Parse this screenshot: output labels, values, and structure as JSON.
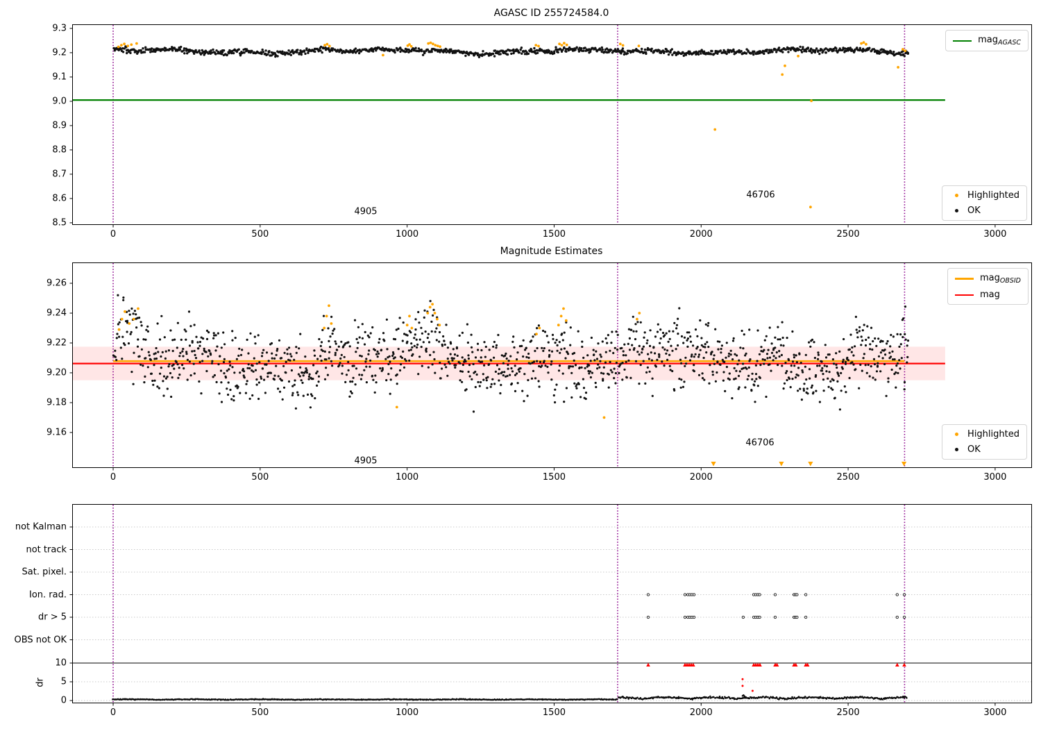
{
  "figure": {
    "background": "#ffffff"
  },
  "colors": {
    "ok": "#111111",
    "highlighted": "#ffa500",
    "mag_agasc_line": "#008000",
    "mag_line": "#ff0000",
    "mag_obsid_line": "#ffa500",
    "band": "rgba(255,60,60,0.13)",
    "vline": "#8a008a",
    "grid": "#c9c9c9",
    "flag_red": "#ff0000"
  },
  "chart_data": [
    {
      "type": "scatter",
      "title": "AGASC ID 255724584.0",
      "xlim": [
        -137,
        3123
      ],
      "ylim": [
        8.494,
        9.314
      ],
      "x_ticks": [
        0,
        500,
        1000,
        1500,
        2000,
        2500,
        3000
      ],
      "x_tick_labels": [
        "0",
        "500",
        "1000",
        "1500",
        "2000",
        "2500",
        "3000"
      ],
      "y_ticks": [
        9.3,
        9.2,
        9.1,
        9.0,
        8.9,
        8.8,
        8.7,
        8.6,
        8.5
      ],
      "y_tick_labels": [
        "9.3",
        "9.2",
        "9.1",
        "9.0",
        "8.9",
        "8.8",
        "8.7",
        "8.6",
        "8.5"
      ],
      "vlines": [
        0,
        1716,
        2692
      ],
      "hline": {
        "label_main": "mag",
        "label_sub": "AGASC",
        "y": 9.005,
        "x0": -137,
        "x1": 2830,
        "color": "#008000"
      },
      "ok_points": {
        "seed": 42,
        "n": 1050,
        "x_min": 2,
        "x_max": 2705,
        "base": 9.205,
        "noise_sd": 0.0055,
        "wander": [
          [
            0.006,
            120,
            0.5
          ],
          [
            0.004,
            37,
            2.1
          ]
        ],
        "bumps": {
          "centers": [
            30,
            730,
            1010,
            1090,
            1450,
            1530,
            2550
          ],
          "amp": 0.009,
          "width": 22
        },
        "clamp": [
          9.178,
          9.236
        ]
      },
      "highlighted_points": [
        [
          18,
          9.224
        ],
        [
          28,
          9.231
        ],
        [
          38,
          9.236
        ],
        [
          50,
          9.228
        ],
        [
          62,
          9.233
        ],
        [
          80,
          9.238
        ],
        [
          720,
          9.231
        ],
        [
          728,
          9.235
        ],
        [
          736,
          9.227
        ],
        [
          918,
          9.19
        ],
        [
          1002,
          9.229
        ],
        [
          1008,
          9.234
        ],
        [
          1014,
          9.226
        ],
        [
          1072,
          9.238
        ],
        [
          1080,
          9.241
        ],
        [
          1088,
          9.236
        ],
        [
          1096,
          9.231
        ],
        [
          1104,
          9.228
        ],
        [
          1112,
          9.225
        ],
        [
          1438,
          9.231
        ],
        [
          1447,
          9.227
        ],
        [
          1518,
          9.236
        ],
        [
          1526,
          9.231
        ],
        [
          1534,
          9.239
        ],
        [
          1543,
          9.232
        ],
        [
          1725,
          9.236
        ],
        [
          1734,
          9.23
        ],
        [
          1788,
          9.228
        ],
        [
          2047,
          8.884
        ],
        [
          2276,
          9.11
        ],
        [
          2285,
          9.146
        ],
        [
          2330,
          9.186
        ],
        [
          2372,
          8.565
        ],
        [
          2375,
          9.002
        ],
        [
          2545,
          9.238
        ],
        [
          2553,
          9.242
        ],
        [
          2561,
          9.235
        ],
        [
          2670,
          9.14
        ],
        [
          2686,
          9.214
        ],
        [
          2694,
          9.208
        ]
      ],
      "scatter_legend": {
        "highlighted": "Highlighted",
        "ok": "OK"
      },
      "annotations": [
        {
          "text": "4905",
          "x": 859
        },
        {
          "text": "46706",
          "x": 2202
        }
      ]
    },
    {
      "type": "scatter",
      "title": "Magnitude Estimates",
      "xlim": [
        -137,
        3123
      ],
      "ylim": [
        9.1367,
        9.2735
      ],
      "x_ticks": [
        0,
        500,
        1000,
        1500,
        2000,
        2500,
        3000
      ],
      "x_tick_labels": [
        "0",
        "500",
        "1000",
        "1500",
        "2000",
        "2500",
        "3000"
      ],
      "y_ticks": [
        9.26,
        9.24,
        9.22,
        9.2,
        9.18,
        9.16
      ],
      "y_tick_labels": [
        "9.26",
        "9.24",
        "9.22",
        "9.20",
        "9.18",
        "9.16"
      ],
      "vlines": [
        0,
        1716,
        2692
      ],
      "band": {
        "y0": 9.195,
        "y1": 9.2175,
        "x0": -137,
        "x1": 2830
      },
      "hlines": [
        {
          "label_main": "mag",
          "label_sub": "OBSID",
          "y": 9.2078,
          "x0": 0,
          "x1": 2692,
          "color": "#ffa500",
          "width": 2.6
        },
        {
          "label_main": "mag",
          "y": 9.2062,
          "x0": -137,
          "x1": 2830,
          "color": "#ff0000",
          "width": 2.2
        }
      ],
      "ok_points": {
        "seed": 99,
        "n": 1400,
        "x_min": 2,
        "x_max": 2705,
        "base": 9.206,
        "noise_sd": 0.011,
        "wander": [
          [
            0.005,
            140,
            0.3
          ],
          [
            0.003,
            45,
            1.7
          ]
        ],
        "bumps": {
          "centers": [
            30,
            70,
            730,
            1010,
            1085,
            1450,
            1530,
            1786,
            1870,
            2250,
            2550,
            2690
          ],
          "amp": 0.019,
          "width": 24
        },
        "clamp": [
          9.167,
          9.252
        ]
      },
      "highlighted_points": [
        [
          20,
          9.229
        ],
        [
          30,
          9.236
        ],
        [
          40,
          9.241
        ],
        [
          55,
          9.233
        ],
        [
          70,
          9.236
        ],
        [
          85,
          9.243
        ],
        [
          718,
          9.23
        ],
        [
          726,
          9.238
        ],
        [
          734,
          9.245
        ],
        [
          742,
          9.233
        ],
        [
          965,
          9.177
        ],
        [
          1000,
          9.232
        ],
        [
          1008,
          9.238
        ],
        [
          1016,
          9.23
        ],
        [
          1070,
          9.24
        ],
        [
          1078,
          9.244
        ],
        [
          1086,
          9.246
        ],
        [
          1094,
          9.24
        ],
        [
          1102,
          9.236
        ],
        [
          1110,
          9.232
        ],
        [
          1440,
          9.226
        ],
        [
          1450,
          9.23
        ],
        [
          1515,
          9.232
        ],
        [
          1524,
          9.238
        ],
        [
          1532,
          9.243
        ],
        [
          1541,
          9.235
        ],
        [
          1670,
          9.17
        ],
        [
          1782,
          9.236
        ],
        [
          1790,
          9.24
        ]
      ],
      "clipped_triangles_x": [
        2042,
        2273,
        2372,
        2690
      ],
      "scatter_legend": {
        "highlighted": "Highlighted",
        "ok": "OK"
      },
      "annotations": [
        {
          "text": "4905",
          "x": 859
        },
        {
          "text": "46706",
          "x": 2200
        }
      ]
    },
    {
      "type": "flags",
      "categories": [
        "not Kalman",
        "not track",
        "Sat. pixel.",
        "Ion. rad.",
        "dr > 5",
        "OBS not OK"
      ],
      "dr_label": "dr",
      "dr_ticks": [
        10,
        5,
        0
      ],
      "dr_tick_labels": [
        "10",
        "5",
        "0"
      ],
      "x_ticks": [
        0,
        500,
        1000,
        1500,
        2000,
        2500,
        3000
      ],
      "x_tick_labels": [
        "0",
        "500",
        "1000",
        "1500",
        "2000",
        "2500",
        "3000"
      ],
      "vlines": [
        0,
        1716,
        2692
      ],
      "dr10_line": 10,
      "ion_rad_x": [
        1820,
        1945,
        1955,
        1962,
        1969,
        1976,
        2179,
        2186,
        2193,
        2199,
        2252,
        2316,
        2321,
        2326,
        2356,
        2667,
        2691
      ],
      "dr_gt5_x": [
        1820,
        1945,
        1955,
        1962,
        1969,
        1976,
        2143,
        2179,
        2186,
        2193,
        2199,
        2252,
        2316,
        2321,
        2326,
        2356,
        2667,
        2691
      ],
      "red_at_10_x": [
        1820,
        1945,
        1952,
        1959,
        1966,
        1973,
        2179,
        2186,
        2193,
        2200,
        2252,
        2258,
        2316,
        2322,
        2356,
        2362,
        2667,
        2691
      ],
      "red_loose": [
        [
          2141,
          5.7
        ],
        [
          2141,
          3.9
        ],
        [
          2175,
          2.6
        ]
      ],
      "dr_extra_black": [
        [
          2141,
          1.25
        ],
        [
          2144,
          1.45
        ],
        [
          2147,
          1.2
        ],
        [
          2150,
          0.95
        ],
        [
          2063,
          1.1
        ]
      ],
      "dr_trace": {
        "seed": 7,
        "n": 980,
        "x_min": 0,
        "x_max": 2700,
        "split_x": 1716,
        "quiet": {
          "base": 0.22,
          "amp": 0.1,
          "period": 73,
          "noise": 0.05
        },
        "active": {
          "base": 0.5,
          "amp": 0.35,
          "period": 52,
          "noise": 0.12
        },
        "clamp": [
          0.04,
          1.75
        ]
      }
    }
  ]
}
